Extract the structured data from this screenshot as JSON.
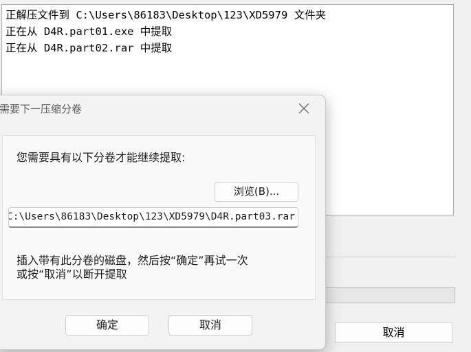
{
  "log": {
    "lines": [
      "正解压文件到 C:\\Users\\86183\\Desktop\\123\\XD5979 文件夹",
      "正在从 D4R.part01.exe 中提取",
      "正在从 D4R.part02.rar 中提取"
    ]
  },
  "background": {
    "cancel_label": "取消",
    "progress_fraction": 0.0,
    "progress_color": "#06b025"
  },
  "dialog": {
    "title": "需要下一压缩分卷",
    "close_icon": "close-icon",
    "prompt": "您需要具有以下分卷才能继续提取:",
    "browse_label": "浏览(B)...",
    "path_value": "C:\\Users\\86183\\Desktop\\123\\XD5979\\D4R.part03.rar",
    "instructions_line1": "插入带有此分卷的磁盘，然后按“确定”再试一次",
    "instructions_line2": "或按“取消”以断开提取",
    "ok_label": "确定",
    "cancel_label": "取消"
  }
}
